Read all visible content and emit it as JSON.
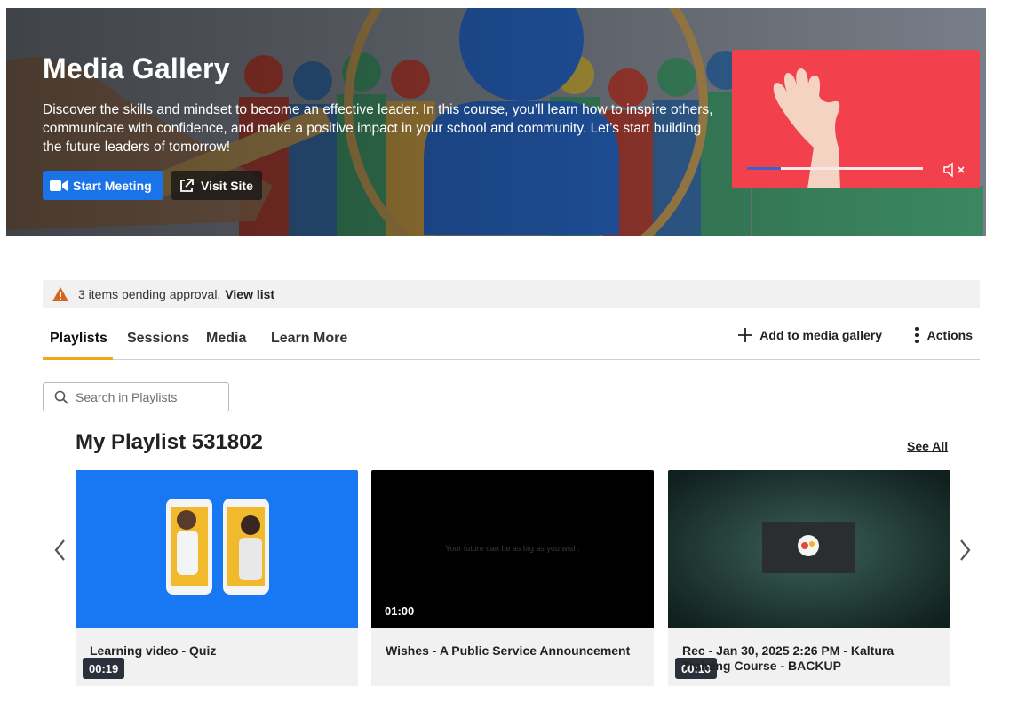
{
  "hero": {
    "title": "Media Gallery",
    "description": "Discover the skills and mindset to become an effective leader. In this course, you’ll learn how to inspire others, communicate with confidence, and make a positive impact in your school and community. Let’s start building the future leaders of tomorrow!",
    "start_meeting_label": "Start Meeting",
    "visit_site_label": "Visit Site",
    "video_progress": 0.19
  },
  "alert": {
    "text": "3 items pending approval.",
    "link_label": "View list"
  },
  "tabs": [
    {
      "label": "Playlists",
      "active": true
    },
    {
      "label": "Sessions"
    },
    {
      "label": "Media"
    },
    {
      "label": "Learn More"
    }
  ],
  "toolbar": {
    "add_label": "Add to media gallery",
    "actions_label": "Actions"
  },
  "search": {
    "placeholder": "Search in Playlists"
  },
  "playlist": {
    "title": "My Playlist 531802",
    "see_all_label": "See All",
    "cards": [
      {
        "duration": "00:19",
        "title": "Learning video - Quiz"
      },
      {
        "duration": "01:00",
        "title": "Wishes - A Public Service Announcement",
        "thumb_caption": "Your future can be as big as you wish."
      },
      {
        "duration": "00:10",
        "title": "Rec - Jan 30, 2025 2:26 PM - Kaltura Training Course - BACKUP"
      }
    ]
  },
  "colors": {
    "accent": "#1a73e8",
    "tab_underline": "#f0a818",
    "warning": "#d4661f",
    "video_bg": "#f2404d"
  }
}
